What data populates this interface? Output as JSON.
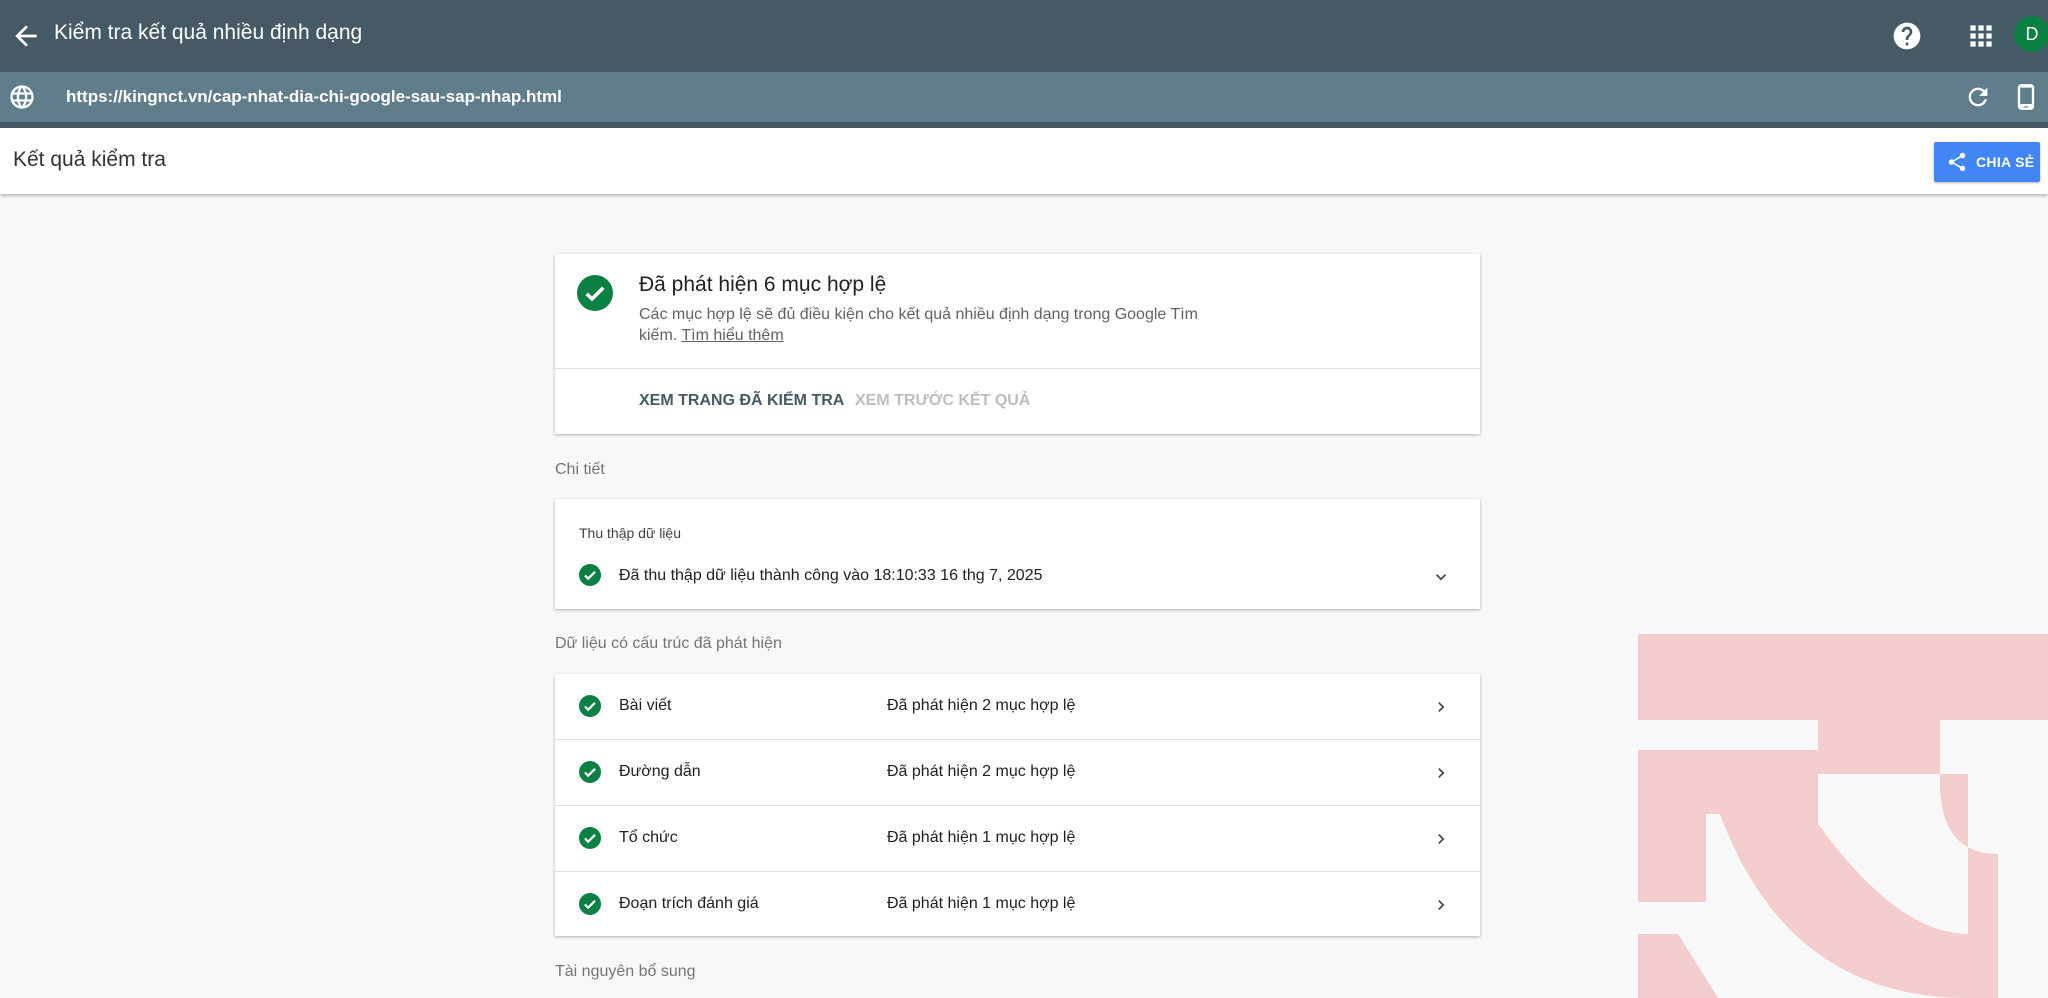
{
  "colors": {
    "topbar": "#455a64",
    "urlbar": "#607d8b",
    "success_green": "#0b8043",
    "share_button": "#4285f4",
    "watermark": "#f3cccd"
  },
  "topbar": {
    "title": "Kiểm tra kết quả nhiều định dạng",
    "avatar_letter": "D",
    "icons": [
      "back-arrow-icon",
      "help-icon",
      "apps-grid-icon"
    ]
  },
  "urlbar": {
    "url": "https://kingnct.vn/cap-nhat-dia-chi-google-sau-sap-nhap.html",
    "icons": [
      "globe-icon",
      "reload-icon",
      "mobile-device-icon"
    ]
  },
  "page": {
    "title": "Kết quả kiểm tra",
    "share_label": "CHIA SẺ"
  },
  "summary": {
    "heading": "Đã phát hiện 6 mục hợp lệ",
    "description": "Các mục hợp lệ sẽ đủ điều kiện cho kết quả nhiều định dạng trong Google Tìm kiếm.",
    "learn_more": "Tìm hiểu thêm",
    "view_tested_page": "XEM TRANG ĐÃ KIỂM TRA",
    "preview_results": "XEM TRƯỚC KẾT QUẢ"
  },
  "details": {
    "label": "Chi tiết",
    "crawl_heading": "Thu thập dữ liệu",
    "crawl_status": "Đã thu thập dữ liệu thành công vào 18:10:33 16 thg 7, 2025"
  },
  "structured_data": {
    "label": "Dữ liệu có cấu trúc đã phát hiện",
    "items": [
      {
        "name": "Bài viết",
        "status": "Đã phát hiện 2 mục hợp lệ"
      },
      {
        "name": "Đường dẫn",
        "status": "Đã phát hiện 2 mục hợp lệ"
      },
      {
        "name": "Tổ chức",
        "status": "Đã phát hiện 1 mục hợp lệ"
      },
      {
        "name": "Đoạn trích đánh giá",
        "status": "Đã phát hiện 1 mục hợp lệ"
      }
    ]
  },
  "additional_resources": {
    "label": "Tài nguyên bổ sung"
  }
}
